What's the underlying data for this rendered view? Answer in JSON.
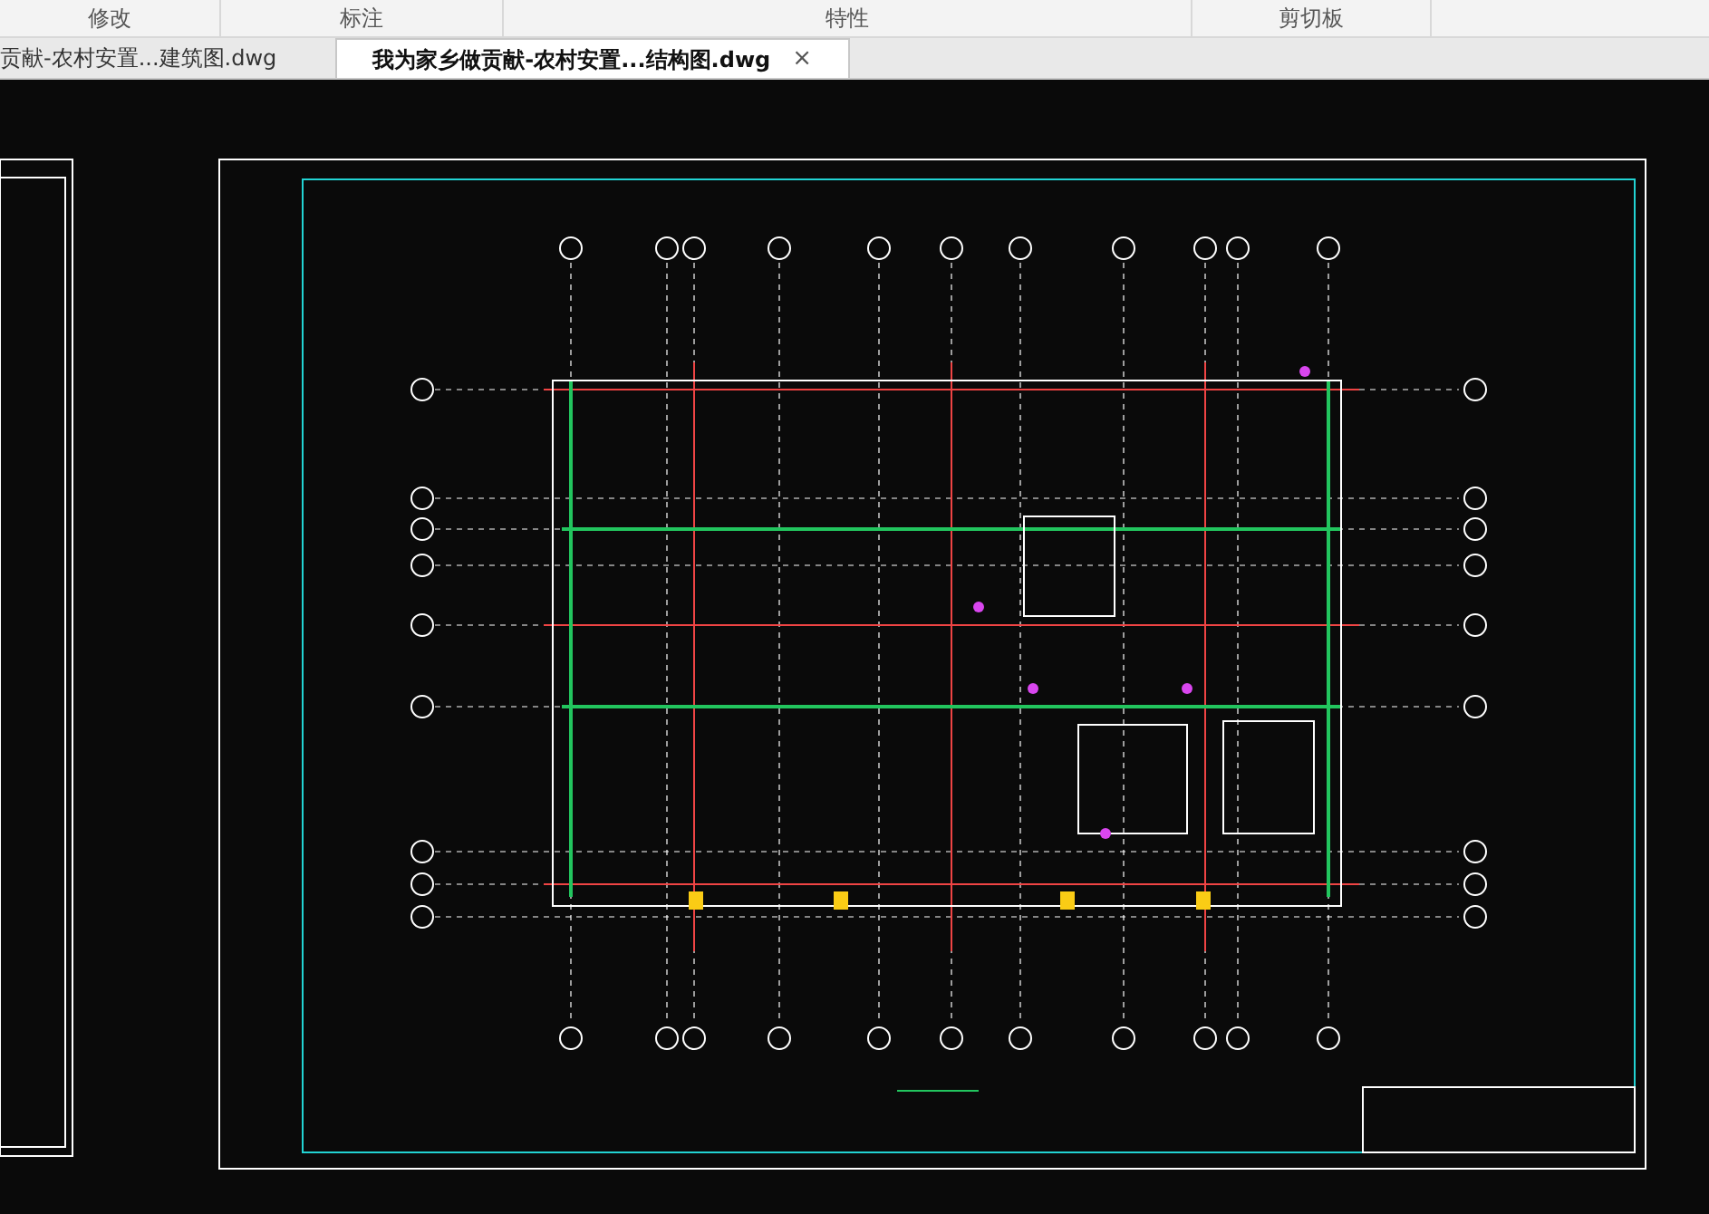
{
  "ribbon_panels": [
    "修改",
    "标注",
    "特性",
    "剪切板"
  ],
  "tabs": [
    {
      "label": "贡献-农村安置...建筑图.dwg",
      "selected": false
    },
    {
      "label": "我为家乡做贡献-农村安置...结构图.dwg",
      "selected": true,
      "close": "×"
    }
  ]
}
